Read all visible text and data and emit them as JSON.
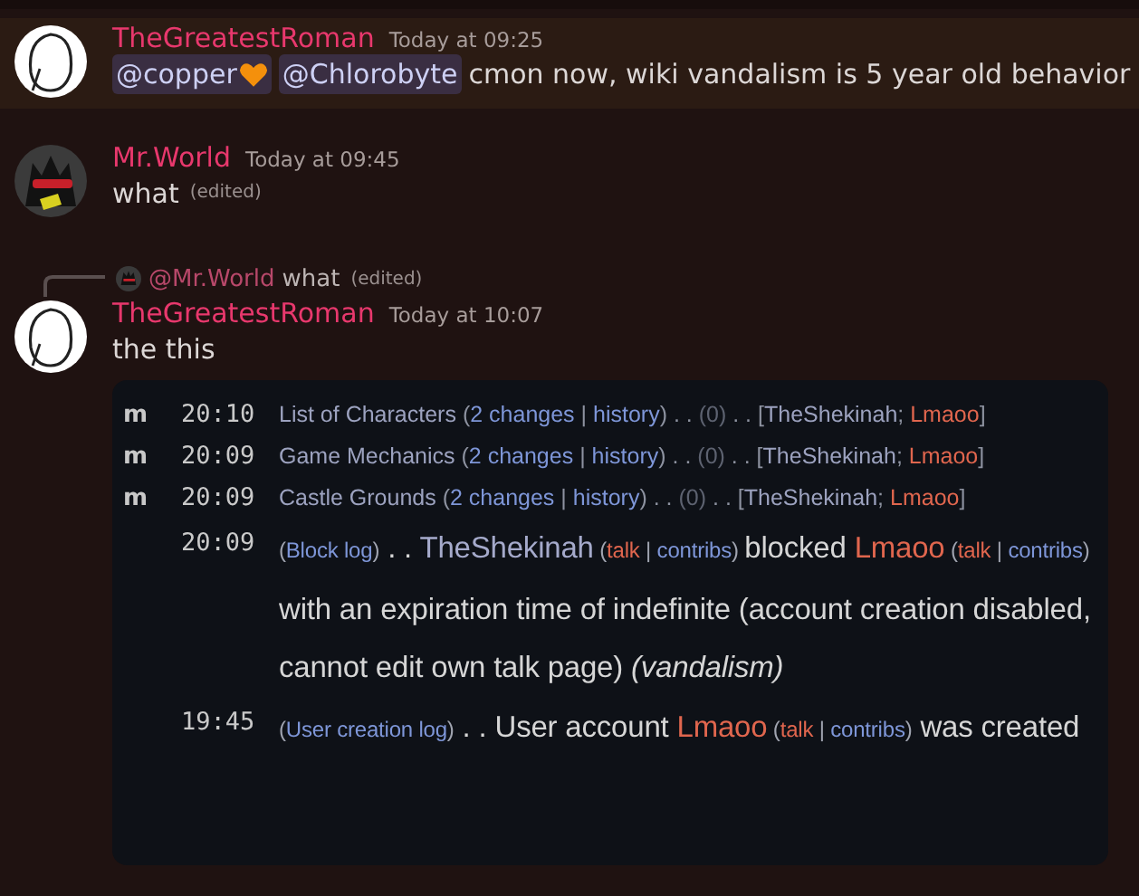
{
  "messages": [
    {
      "author": "TheGreatestRoman",
      "timestamp": "Today at 09:25",
      "highlighted": true,
      "avatar": {
        "kind": "light"
      },
      "content": [
        {
          "kind": "mention",
          "text": "@copper",
          "heart": true
        },
        {
          "kind": "mention",
          "text": "@Chlorobyte"
        },
        {
          "kind": "text",
          "text": "cmon now, wiki vandalism is 5 year old behavior"
        }
      ]
    },
    {
      "author": "Mr.World",
      "timestamp": "Today at 09:45",
      "highlighted": false,
      "avatar": {
        "kind": "dark"
      },
      "content": [
        {
          "kind": "text",
          "text": "what"
        },
        {
          "kind": "edited",
          "text": "(edited)"
        }
      ]
    },
    {
      "author": "TheGreatestRoman",
      "timestamp": "Today at 10:07",
      "highlighted": false,
      "avatar": {
        "kind": "light"
      },
      "reply": {
        "author": "@Mr.World",
        "avatar": {
          "kind": "dark"
        },
        "text": "what",
        "edited": "(edited)"
      },
      "content": [
        {
          "kind": "text",
          "text": "the this"
        }
      ],
      "embed": {
        "entries": [
          {
            "kind": "edit",
            "mark": "m",
            "time": "20:10",
            "segments": [
              {
                "kind": "title",
                "text": "List of Characters"
              },
              {
                "kind": "text",
                "text": " ("
              },
              {
                "kind": "link",
                "text": "2 changes"
              },
              {
                "kind": "text",
                "text": " | "
              },
              {
                "kind": "link",
                "text": "history"
              },
              {
                "kind": "text",
                "text": ") . . "
              },
              {
                "kind": "dim",
                "text": "(0)"
              },
              {
                "kind": "text",
                "text": " . . ["
              },
              {
                "kind": "title",
                "text": "TheShekinah"
              },
              {
                "kind": "text",
                "text": "; "
              },
              {
                "kind": "red",
                "text": "Lmaoo"
              },
              {
                "kind": "text",
                "text": "]"
              }
            ]
          },
          {
            "kind": "edit",
            "mark": "m",
            "time": "20:09",
            "segments": [
              {
                "kind": "title",
                "text": "Game Mechanics"
              },
              {
                "kind": "text",
                "text": " ("
              },
              {
                "kind": "link",
                "text": "2 changes"
              },
              {
                "kind": "text",
                "text": " | "
              },
              {
                "kind": "link",
                "text": "history"
              },
              {
                "kind": "text",
                "text": ") . . "
              },
              {
                "kind": "dim",
                "text": "(0)"
              },
              {
                "kind": "text",
                "text": " . . ["
              },
              {
                "kind": "title",
                "text": "TheShekinah"
              },
              {
                "kind": "text",
                "text": "; "
              },
              {
                "kind": "red",
                "text": "Lmaoo"
              },
              {
                "kind": "text",
                "text": "]"
              }
            ]
          },
          {
            "kind": "edit",
            "mark": "m",
            "time": "20:09",
            "segments": [
              {
                "kind": "title",
                "text": "Castle Grounds"
              },
              {
                "kind": "text",
                "text": " ("
              },
              {
                "kind": "link",
                "text": "2 changes"
              },
              {
                "kind": "text",
                "text": " | "
              },
              {
                "kind": "link",
                "text": "history"
              },
              {
                "kind": "text",
                "text": ") . . "
              },
              {
                "kind": "dim",
                "text": "(0)"
              },
              {
                "kind": "text",
                "text": " . . ["
              },
              {
                "kind": "title",
                "text": "TheShekinah"
              },
              {
                "kind": "text",
                "text": "; "
              },
              {
                "kind": "red",
                "text": "Lmaoo"
              },
              {
                "kind": "text",
                "text": "]"
              }
            ]
          },
          {
            "kind": "log",
            "time": "20:09",
            "segments": [
              {
                "kind": "sm-text",
                "text": "("
              },
              {
                "kind": "sm-link",
                "text": "Block log"
              },
              {
                "kind": "sm-text",
                "text": ")"
              },
              {
                "kind": "big",
                "text": " . . "
              },
              {
                "kind": "big-user",
                "text": "TheShekinah"
              },
              {
                "kind": "sm-text",
                "text": " ("
              },
              {
                "kind": "sm-red",
                "text": "talk"
              },
              {
                "kind": "sm-text",
                "text": " | "
              },
              {
                "kind": "sm-link",
                "text": "contribs"
              },
              {
                "kind": "sm-text",
                "text": ") "
              },
              {
                "kind": "big",
                "text": "blocked "
              },
              {
                "kind": "big-red",
                "text": "Lmaoo"
              },
              {
                "kind": "sm-text",
                "text": " ("
              },
              {
                "kind": "sm-red",
                "text": "talk"
              },
              {
                "kind": "sm-text",
                "text": " | "
              },
              {
                "kind": "sm-link",
                "text": "contribs"
              },
              {
                "kind": "sm-text",
                "text": ") "
              },
              {
                "kind": "big",
                "text": "with an expiration time of indefinite (account creation disabled, cannot edit own talk page) "
              },
              {
                "kind": "big-italic",
                "text": "(vandalism)"
              }
            ]
          },
          {
            "kind": "log",
            "time": "19:45",
            "segments": [
              {
                "kind": "sm-text",
                "text": "("
              },
              {
                "kind": "sm-link",
                "text": "User creation log"
              },
              {
                "kind": "sm-text",
                "text": ")"
              },
              {
                "kind": "big",
                "text": " . . User account "
              },
              {
                "kind": "big-red",
                "text": "Lmaoo"
              },
              {
                "kind": "sm-text",
                "text": " ("
              },
              {
                "kind": "sm-red",
                "text": "talk"
              },
              {
                "kind": "sm-text",
                "text": " | "
              },
              {
                "kind": "sm-link",
                "text": "contribs"
              },
              {
                "kind": "sm-text",
                "text": ")"
              },
              {
                "kind": "big",
                "text": " was created"
              }
            ]
          }
        ]
      }
    }
  ]
}
